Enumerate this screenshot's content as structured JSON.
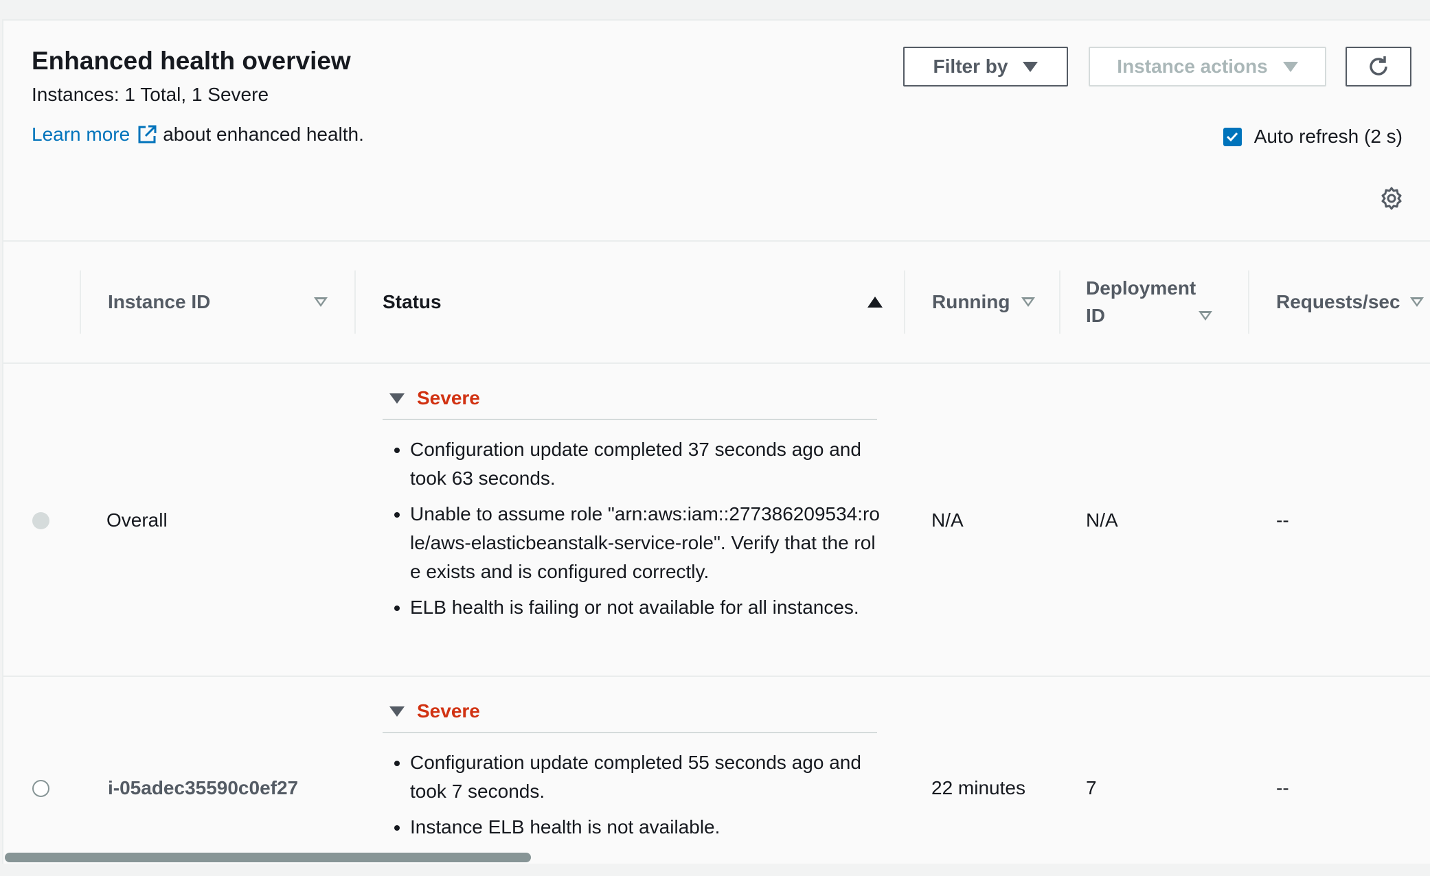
{
  "header": {
    "title": "Enhanced health overview",
    "subtitle": "Instances: 1 Total, 1 Severe",
    "learn_more": "Learn more",
    "learn_more_suffix": "about enhanced health.",
    "filter_label": "Filter by",
    "actions_label": "Instance actions",
    "auto_refresh_label": "Auto refresh (2 s)",
    "auto_refresh_checked": true
  },
  "table": {
    "columns": {
      "instance_id": "Instance ID",
      "status": "Status",
      "running": "Running",
      "deployment_line1": "Deployment",
      "deployment_line2": "ID",
      "requests": "Requests/sec"
    },
    "rows": [
      {
        "id": "Overall",
        "status": "Severe",
        "messages": [
          "Configuration update completed 37 seconds ago and took 63 seconds.",
          "Unable to assume role \"arn:aws:iam::277386209534:role/aws-elasticbeanstalk-service-role\". Verify that the role exists and is configured correctly.",
          "ELB health is failing or not available for all instances."
        ],
        "running": "N/A",
        "deployment_id": "N/A",
        "requests": "--"
      },
      {
        "id": "i-05adec35590c0ef27",
        "status": "Severe",
        "messages": [
          "Configuration update completed 55 seconds ago and took 7 seconds.",
          "Instance ELB health is not available."
        ],
        "running": "22 minutes",
        "deployment_id": "7",
        "requests": "--"
      }
    ]
  },
  "colors": {
    "severe": "#d13212",
    "link": "#0073bb"
  }
}
